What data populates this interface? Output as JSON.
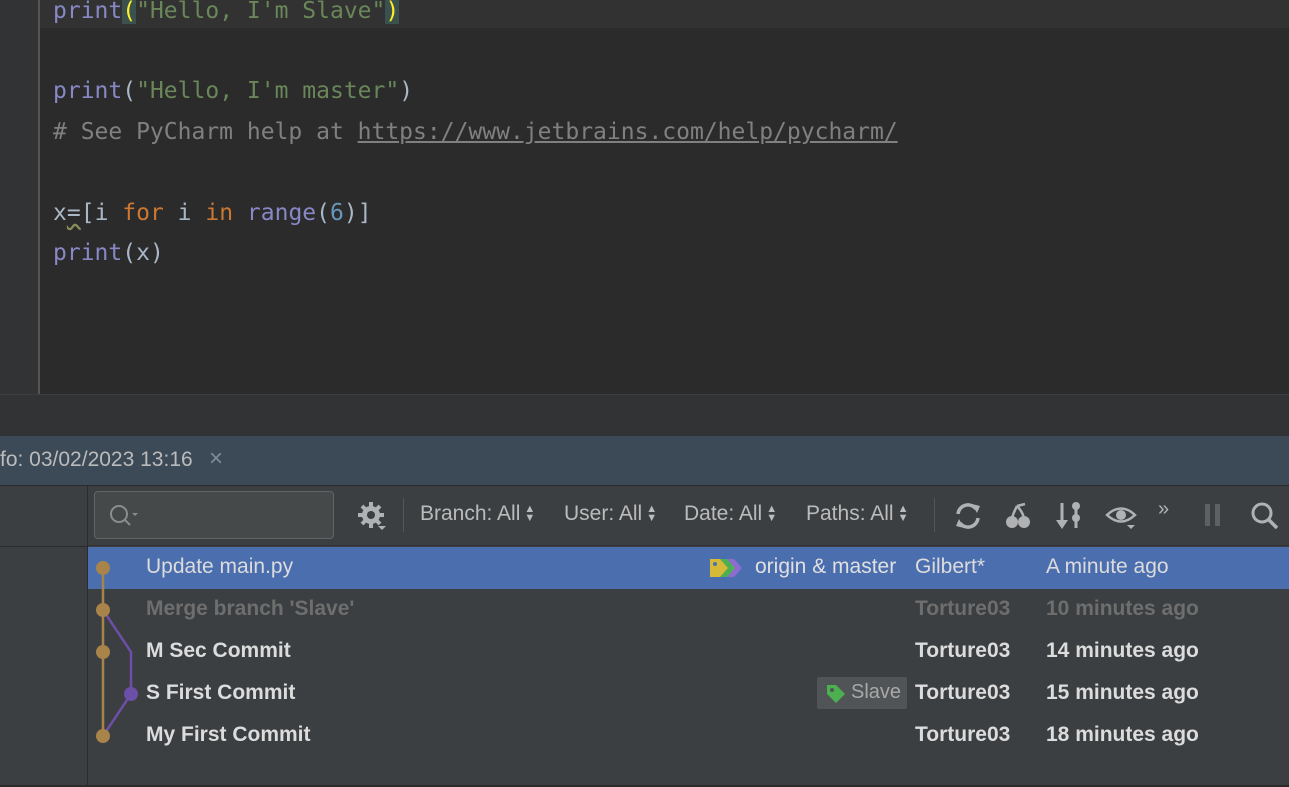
{
  "editor": {
    "lines": [
      {
        "fn": "print",
        "open": "(",
        "str": "\"Hello, I'm Slave\"",
        "close": ")"
      },
      {
        "fn": "print",
        "open": "(",
        "str": "\"Hello, I'm master\"",
        "close": ")"
      },
      {
        "comment": "# See PyCharm help at ",
        "url": "https://www.jetbrains.com/help/pycharm/"
      },
      {
        "var": "x",
        "eq": "=",
        "lb": "[i ",
        "kw_for": "for",
        "mid": " i ",
        "kw_in": "in",
        "sp": " ",
        "fn": "range",
        "po": "(",
        "num": "6",
        "pc": ")]"
      },
      {
        "fn": "print",
        "rest": "(x)"
      }
    ]
  },
  "tool_window": {
    "tab_title": "fo: 03/02/2023 13:16",
    "close_glyph": "×"
  },
  "toolbar": {
    "search_placeholder": "",
    "filters": {
      "branch": "Branch: All",
      "user": "User: All",
      "date": "Date: All",
      "paths": "Paths: All"
    },
    "more_glyph": "»",
    "icons": [
      "settings-icon",
      "refresh-icon",
      "cherry-pick-icon",
      "sort-icon",
      "eye-icon",
      "pause-icon",
      "search-icon"
    ]
  },
  "commits": [
    {
      "subject": "Update main.py",
      "refs": "origin & master",
      "author": "Gilbert*",
      "date": "A minute ago",
      "selected": true
    },
    {
      "subject": "Merge branch 'Slave'",
      "refs": "",
      "author": "Torture03",
      "date": "10 minutes ago",
      "selected": false
    },
    {
      "subject": "M Sec Commit",
      "refs": "",
      "author": "Torture03",
      "date": "14 minutes ago",
      "selected": false
    },
    {
      "subject": "S First Commit",
      "refs": "Slave",
      "author": "Torture03",
      "date": "15 minutes ago",
      "selected": false
    },
    {
      "subject": "My First Commit",
      "refs": "",
      "author": "Torture03",
      "date": "18 minutes ago",
      "selected": false
    }
  ],
  "colors": {
    "selection": "#4b6eaf",
    "master_line": "#a8844a",
    "slave_line": "#6c4fa8",
    "tag_yellow": "#d5b937",
    "tag_green": "#4caf50",
    "tag_purple": "#8e6ccf"
  }
}
